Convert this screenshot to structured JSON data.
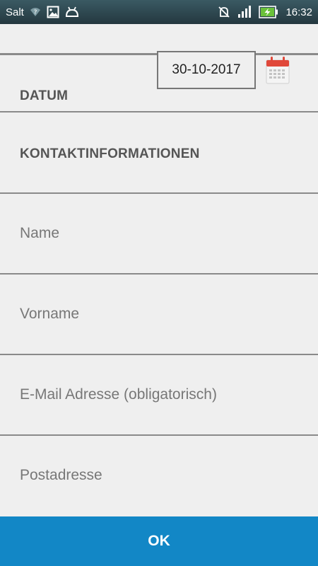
{
  "status_bar": {
    "carrier": "Salt",
    "time": "16:32",
    "icons": [
      "wifi-question-icon",
      "image-icon",
      "android-icon",
      "mute-icon",
      "signal-icon",
      "battery-charging-icon"
    ]
  },
  "form": {
    "date_label": "DATUM",
    "date_value": "30-10-2017",
    "contact_heading": "KONTAKTINFORMATIONEN",
    "fields": {
      "name": "Name",
      "vorname": "Vorname",
      "email": "E-Mail Adresse (obligatorisch)",
      "postadresse": "Postadresse"
    }
  },
  "ok_button": {
    "label": "OK"
  },
  "colors": {
    "accent": "#1287c6",
    "calendar_red": "#e0483a",
    "background": "#efefef"
  }
}
